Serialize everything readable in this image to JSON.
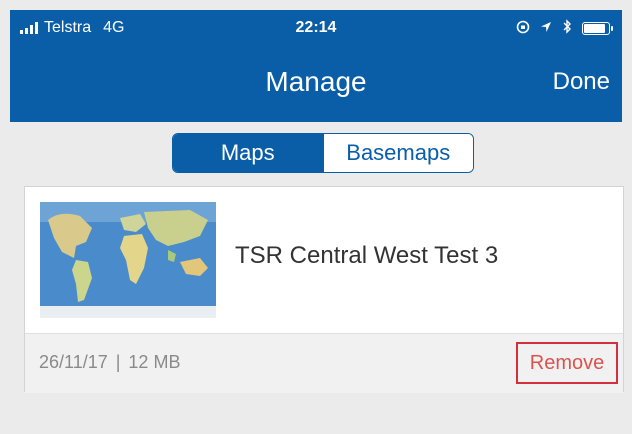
{
  "status_bar": {
    "carrier": "Telstra",
    "network": "4G",
    "time": "22:14",
    "icons": [
      "signal-icon",
      "lock-rotation-icon",
      "location-icon",
      "bluetooth-icon",
      "battery-icon"
    ]
  },
  "nav": {
    "title": "Manage",
    "done_label": "Done"
  },
  "segmented": {
    "items": [
      {
        "label": "Maps",
        "selected": true
      },
      {
        "label": "Basemaps",
        "selected": false
      }
    ]
  },
  "maps": [
    {
      "title": "TSR Central West Test 3",
      "date": "26/11/17",
      "separator": "|",
      "size": "12 MB",
      "remove_label": "Remove"
    }
  ],
  "colors": {
    "primary": "#0a5ea8",
    "remove": "#d9534f",
    "background": "#ebebeb"
  }
}
